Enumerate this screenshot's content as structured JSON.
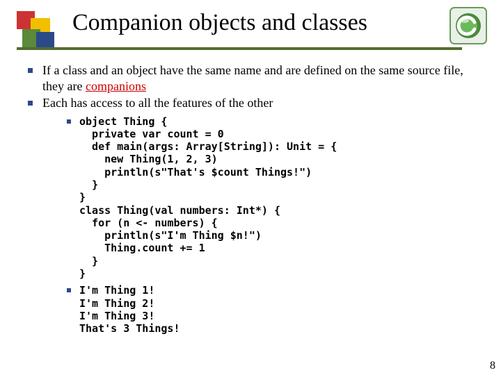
{
  "title": "Companion objects and classes",
  "bullets": [
    {
      "pre": "If a class and an object have the same name and are defined on the same source file, they are ",
      "emph": "companions",
      "post": ""
    },
    {
      "text": "Each has access to all the features of the other"
    }
  ],
  "code1": "object Thing {\n  private var count = 0\n  def main(args: Array[String]): Unit = {\n    new Thing(1, 2, 3)\n    println(s\"That's $count Things!\")\n  }\n}\nclass Thing(val numbers: Int*) {\n  for (n <- numbers) {\n    println(s\"I'm Thing $n!\")\n    Thing.count += 1\n  }\n}",
  "code2": "I'm Thing 1!\nI'm Thing 2!\nI'm Thing 3!\nThat's 3 Things!",
  "pagenum": "8",
  "icons": {
    "corner_logo": "slide-theme-logo",
    "c_badge": "c-language-badge"
  }
}
